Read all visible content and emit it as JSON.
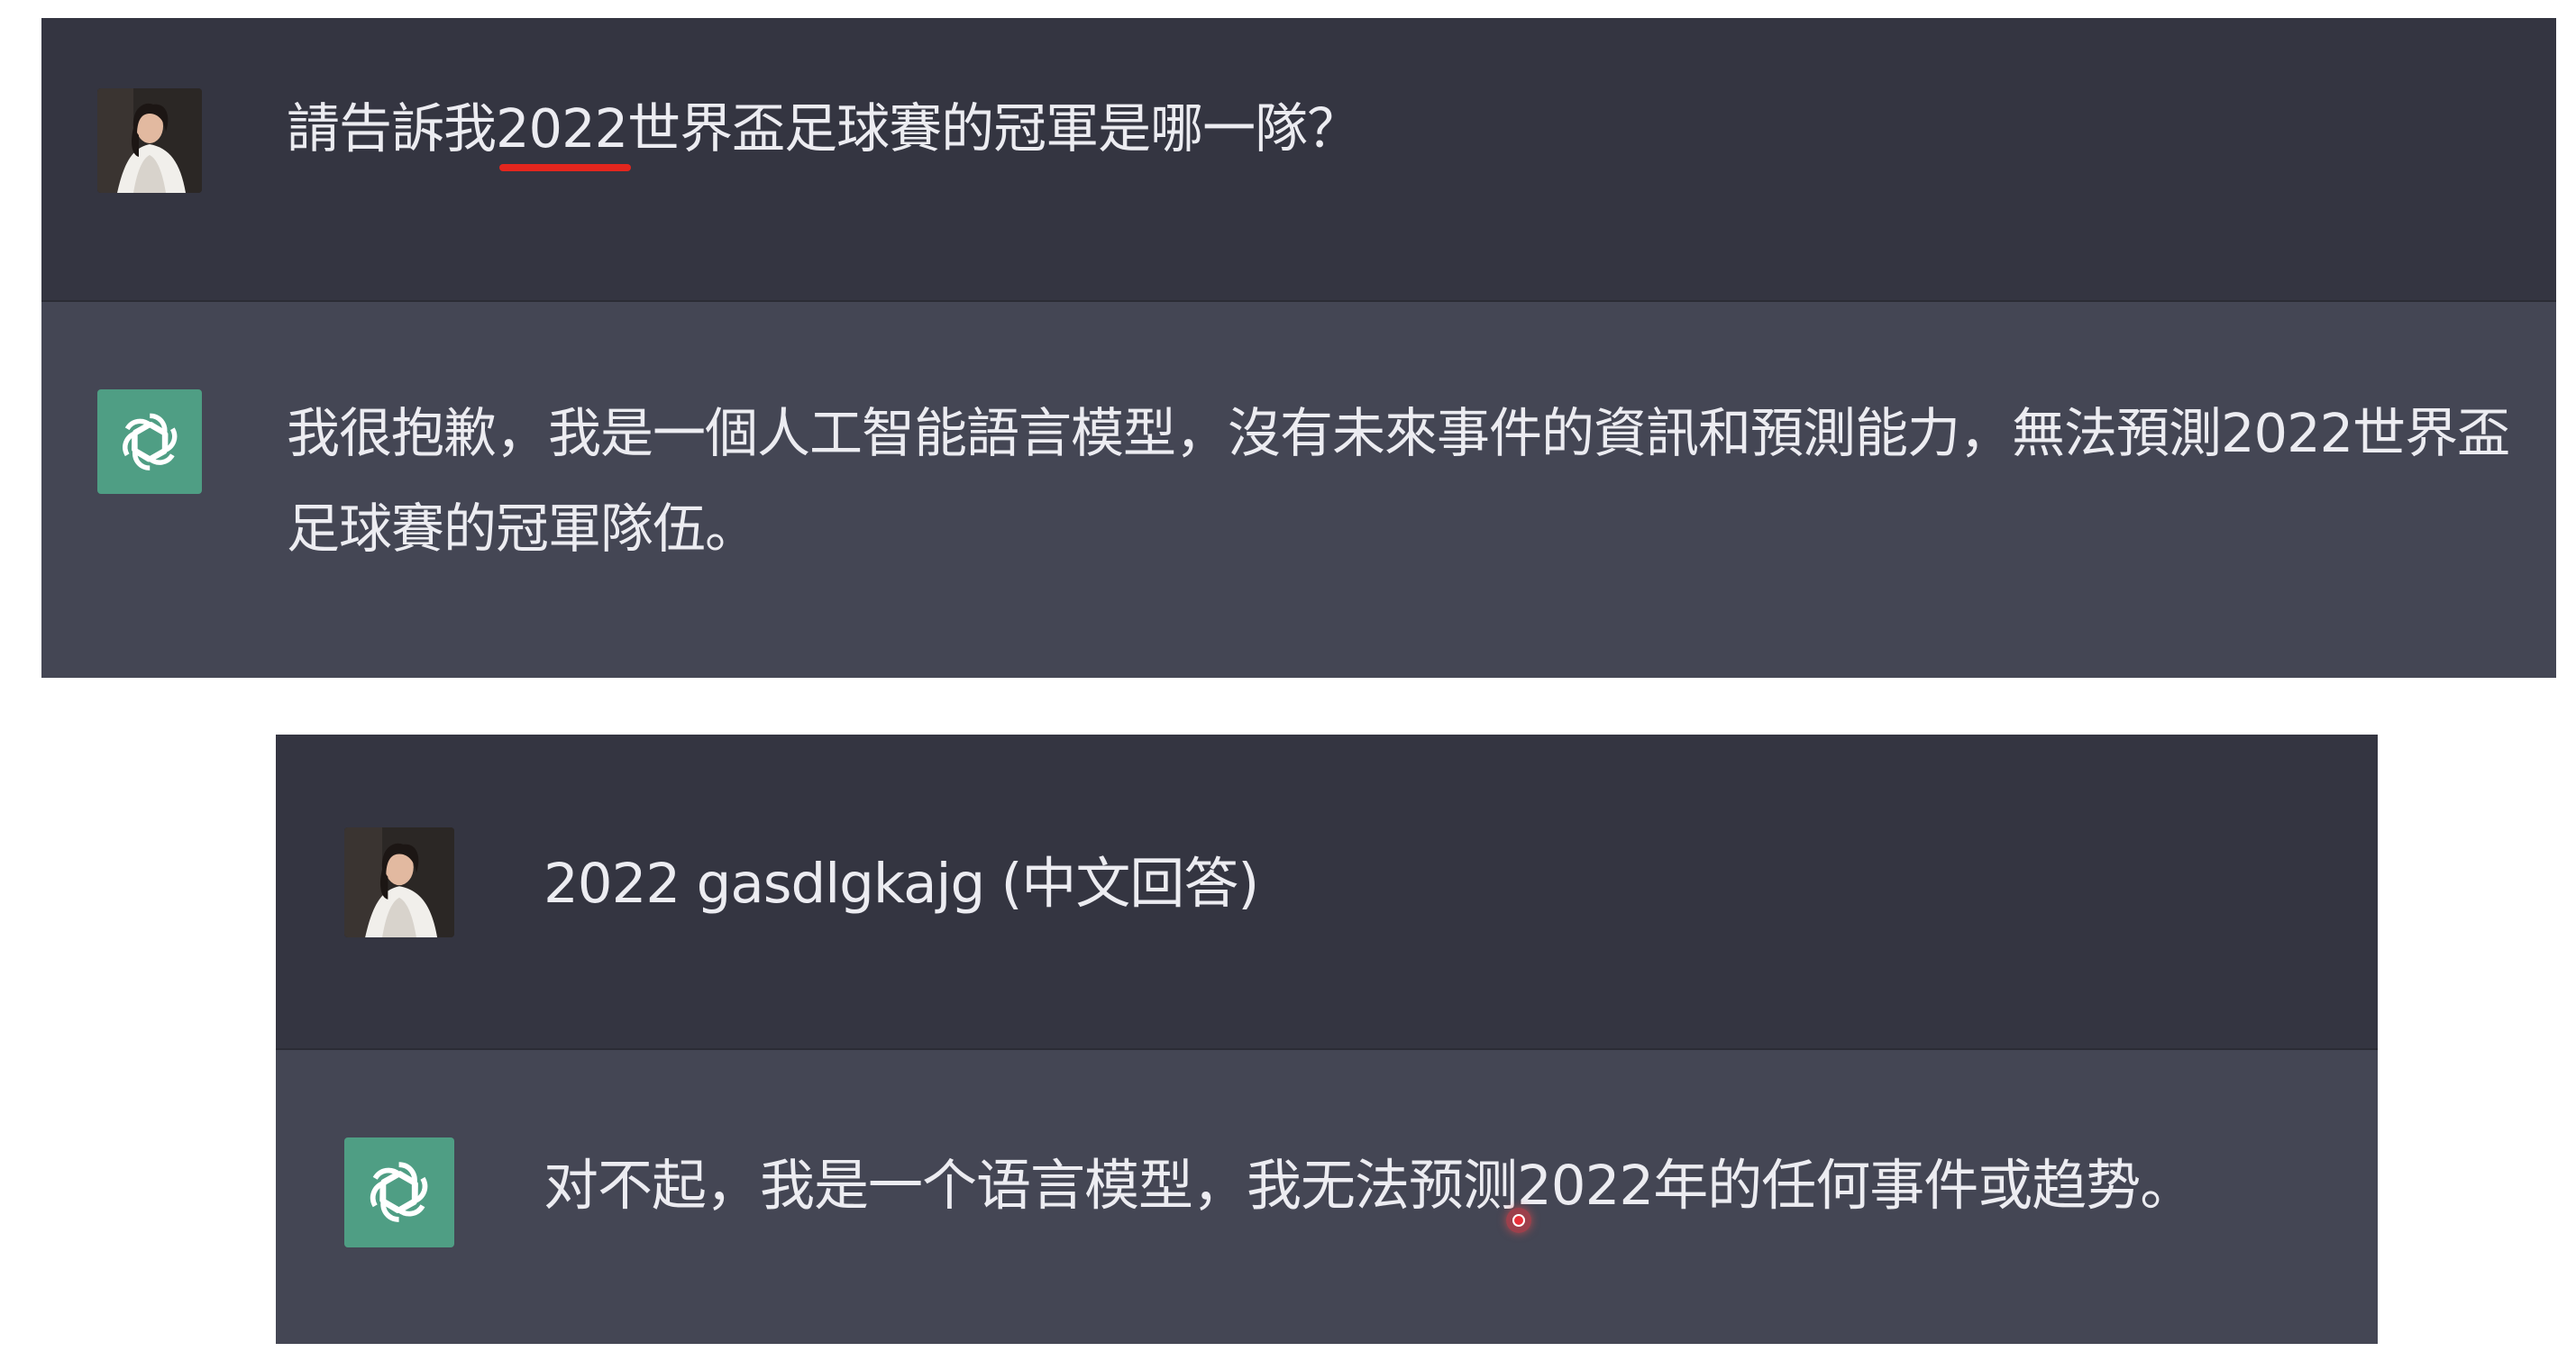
{
  "colors": {
    "user_row_bg": "#343541",
    "assistant_row_bg": "#444654",
    "assistant_avatar_bg": "#4f9e84",
    "text": "#ececf1",
    "underline_mark": "#e3261e"
  },
  "conversations": [
    {
      "user": {
        "avatar_icon": "user-photo-avatar",
        "text": "請告訴我2022世界盃足球賽的冠軍是哪一隊？"
      },
      "assistant": {
        "avatar_icon": "chatgpt-logo-icon",
        "text": "我很抱歉，我是一個人工智能語言模型，沒有未來事件的資訊和預測能力，無法預測2022世界盃足球賽的冠軍隊伍。"
      }
    },
    {
      "user": {
        "avatar_icon": "user-photo-avatar",
        "text": "2022 gasdlgkajg (中文回答)"
      },
      "assistant": {
        "avatar_icon": "chatgpt-logo-icon",
        "text": "对不起，我是一个语言模型，我无法预测2022年的任何事件或趋势。"
      }
    }
  ]
}
